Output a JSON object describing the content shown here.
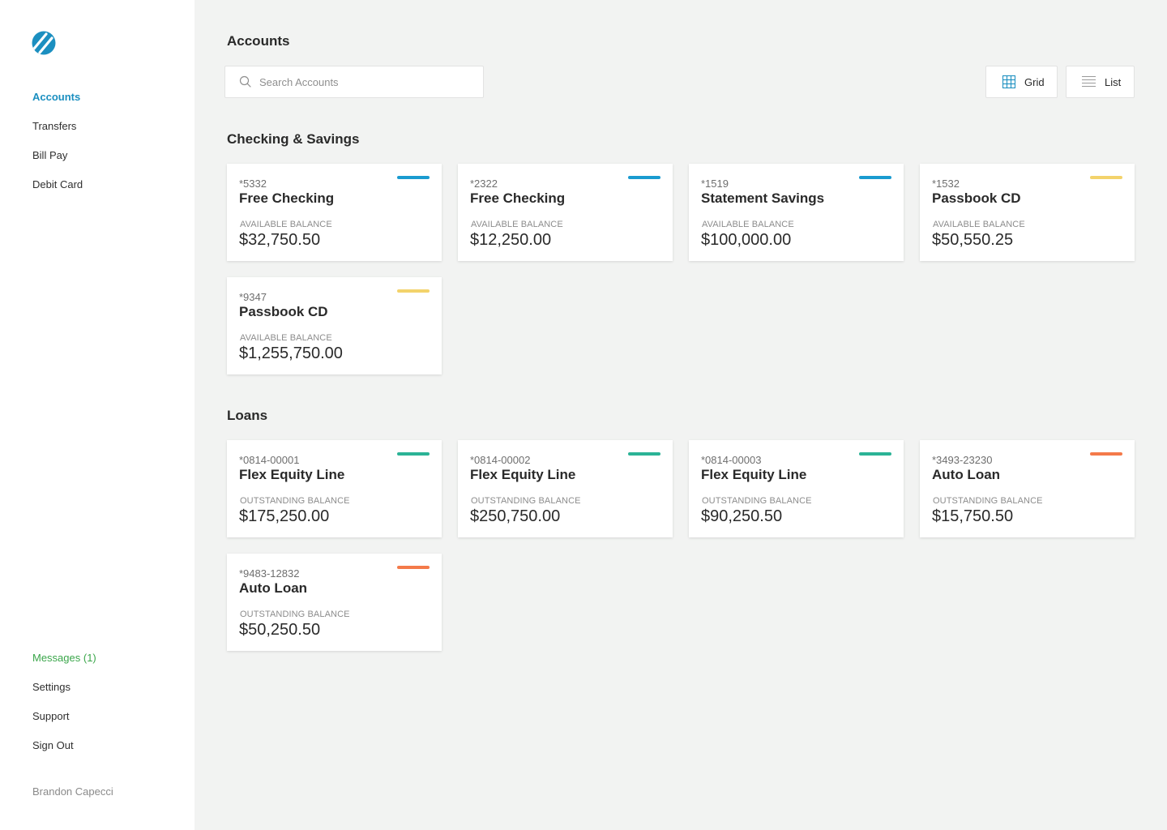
{
  "sidebar": {
    "nav_top": [
      "Accounts",
      "Transfers",
      "Bill Pay",
      "Debit Card"
    ],
    "nav_bottom": [
      "Messages (1)",
      "Settings",
      "Support",
      "Sign Out"
    ],
    "user_name": "Brandon Capecci"
  },
  "header": {
    "title": "Accounts",
    "search_placeholder": "Search Accounts",
    "grid_label": "Grid",
    "list_label": "List",
    "active_view": "grid"
  },
  "colors": {
    "checking": "#1a9bd0",
    "cd": "#f3d36b",
    "equity": "#2bb396",
    "auto": "#f47a4a"
  },
  "sections": [
    {
      "title": "Checking & Savings",
      "balance_label": "AVAILABLE BALANCE",
      "accounts": [
        {
          "number": "*5332",
          "name": "Free Checking",
          "balance": "$32,750.50",
          "color": "#1a9bd0"
        },
        {
          "number": "*2322",
          "name": "Free Checking",
          "balance": "$12,250.00",
          "color": "#1a9bd0"
        },
        {
          "number": "*1519",
          "name": "Statement Savings",
          "balance": "$100,000.00",
          "color": "#1a9bd0"
        },
        {
          "number": "*1532",
          "name": "Passbook CD",
          "balance": "$50,550.25",
          "color": "#f3d36b"
        },
        {
          "number": "*9347",
          "name": "Passbook CD",
          "balance": "$1,255,750.00",
          "color": "#f3d36b"
        }
      ]
    },
    {
      "title": "Loans",
      "balance_label": "OUTSTANDING BALANCE",
      "accounts": [
        {
          "number": "*0814-00001",
          "name": "Flex Equity Line",
          "balance": "$175,250.00",
          "color": "#2bb396"
        },
        {
          "number": "*0814-00002",
          "name": "Flex Equity Line",
          "balance": "$250,750.00",
          "color": "#2bb396"
        },
        {
          "number": "*0814-00003",
          "name": "Flex Equity Line",
          "balance": "$90,250.50",
          "color": "#2bb396"
        },
        {
          "number": "*3493-23230",
          "name": "Auto Loan",
          "balance": "$15,750.50",
          "color": "#f47a4a"
        },
        {
          "number": "*9483-12832",
          "name": "Auto Loan",
          "balance": "$50,250.50",
          "color": "#f47a4a"
        }
      ]
    }
  ]
}
